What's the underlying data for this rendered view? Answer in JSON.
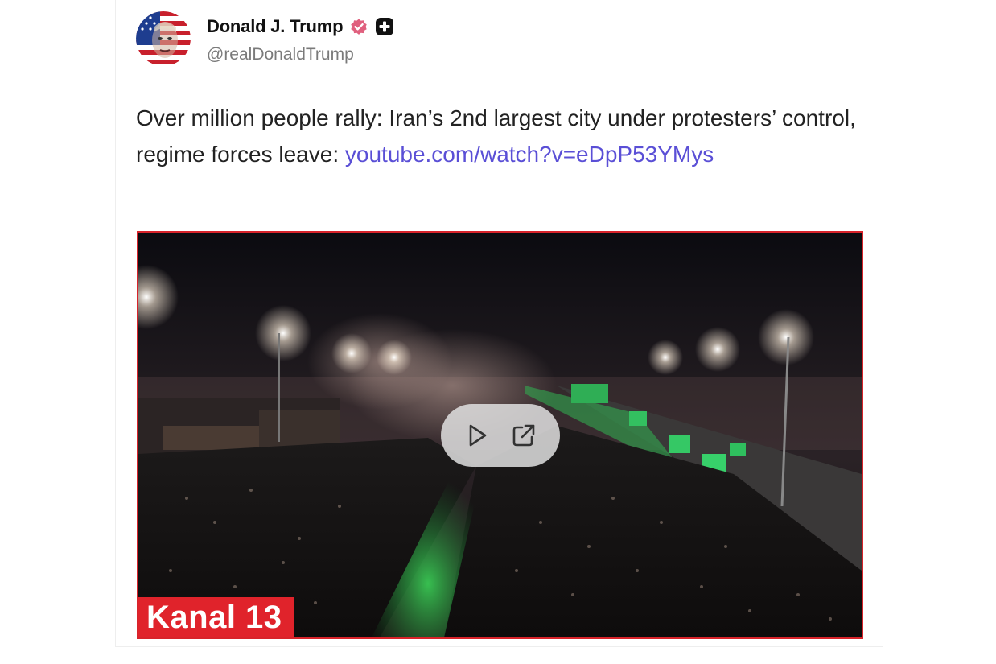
{
  "post": {
    "author": {
      "display_name": "Donald J. Trump",
      "handle": "@realDonaldTrump",
      "avatar_icon": "profile-portrait-flag-avatar",
      "verified_icon": "verified-badge-icon",
      "extra_badge_icon": "plus-badge-icon",
      "verified_color": "#e0607e"
    },
    "text": "Over million people rally: Iran’s 2nd largest city under protesters’ control, regime forces leave: ",
    "link_text": "youtube.com/watch?v=eDpP53YMys",
    "link_color": "#5a4fd6",
    "media": {
      "watermark": "Kanal 13",
      "watermark_color": "#e0232b",
      "border_color": "#d8232a",
      "play_icon": "play-icon",
      "open_external_icon": "external-link-icon"
    }
  }
}
